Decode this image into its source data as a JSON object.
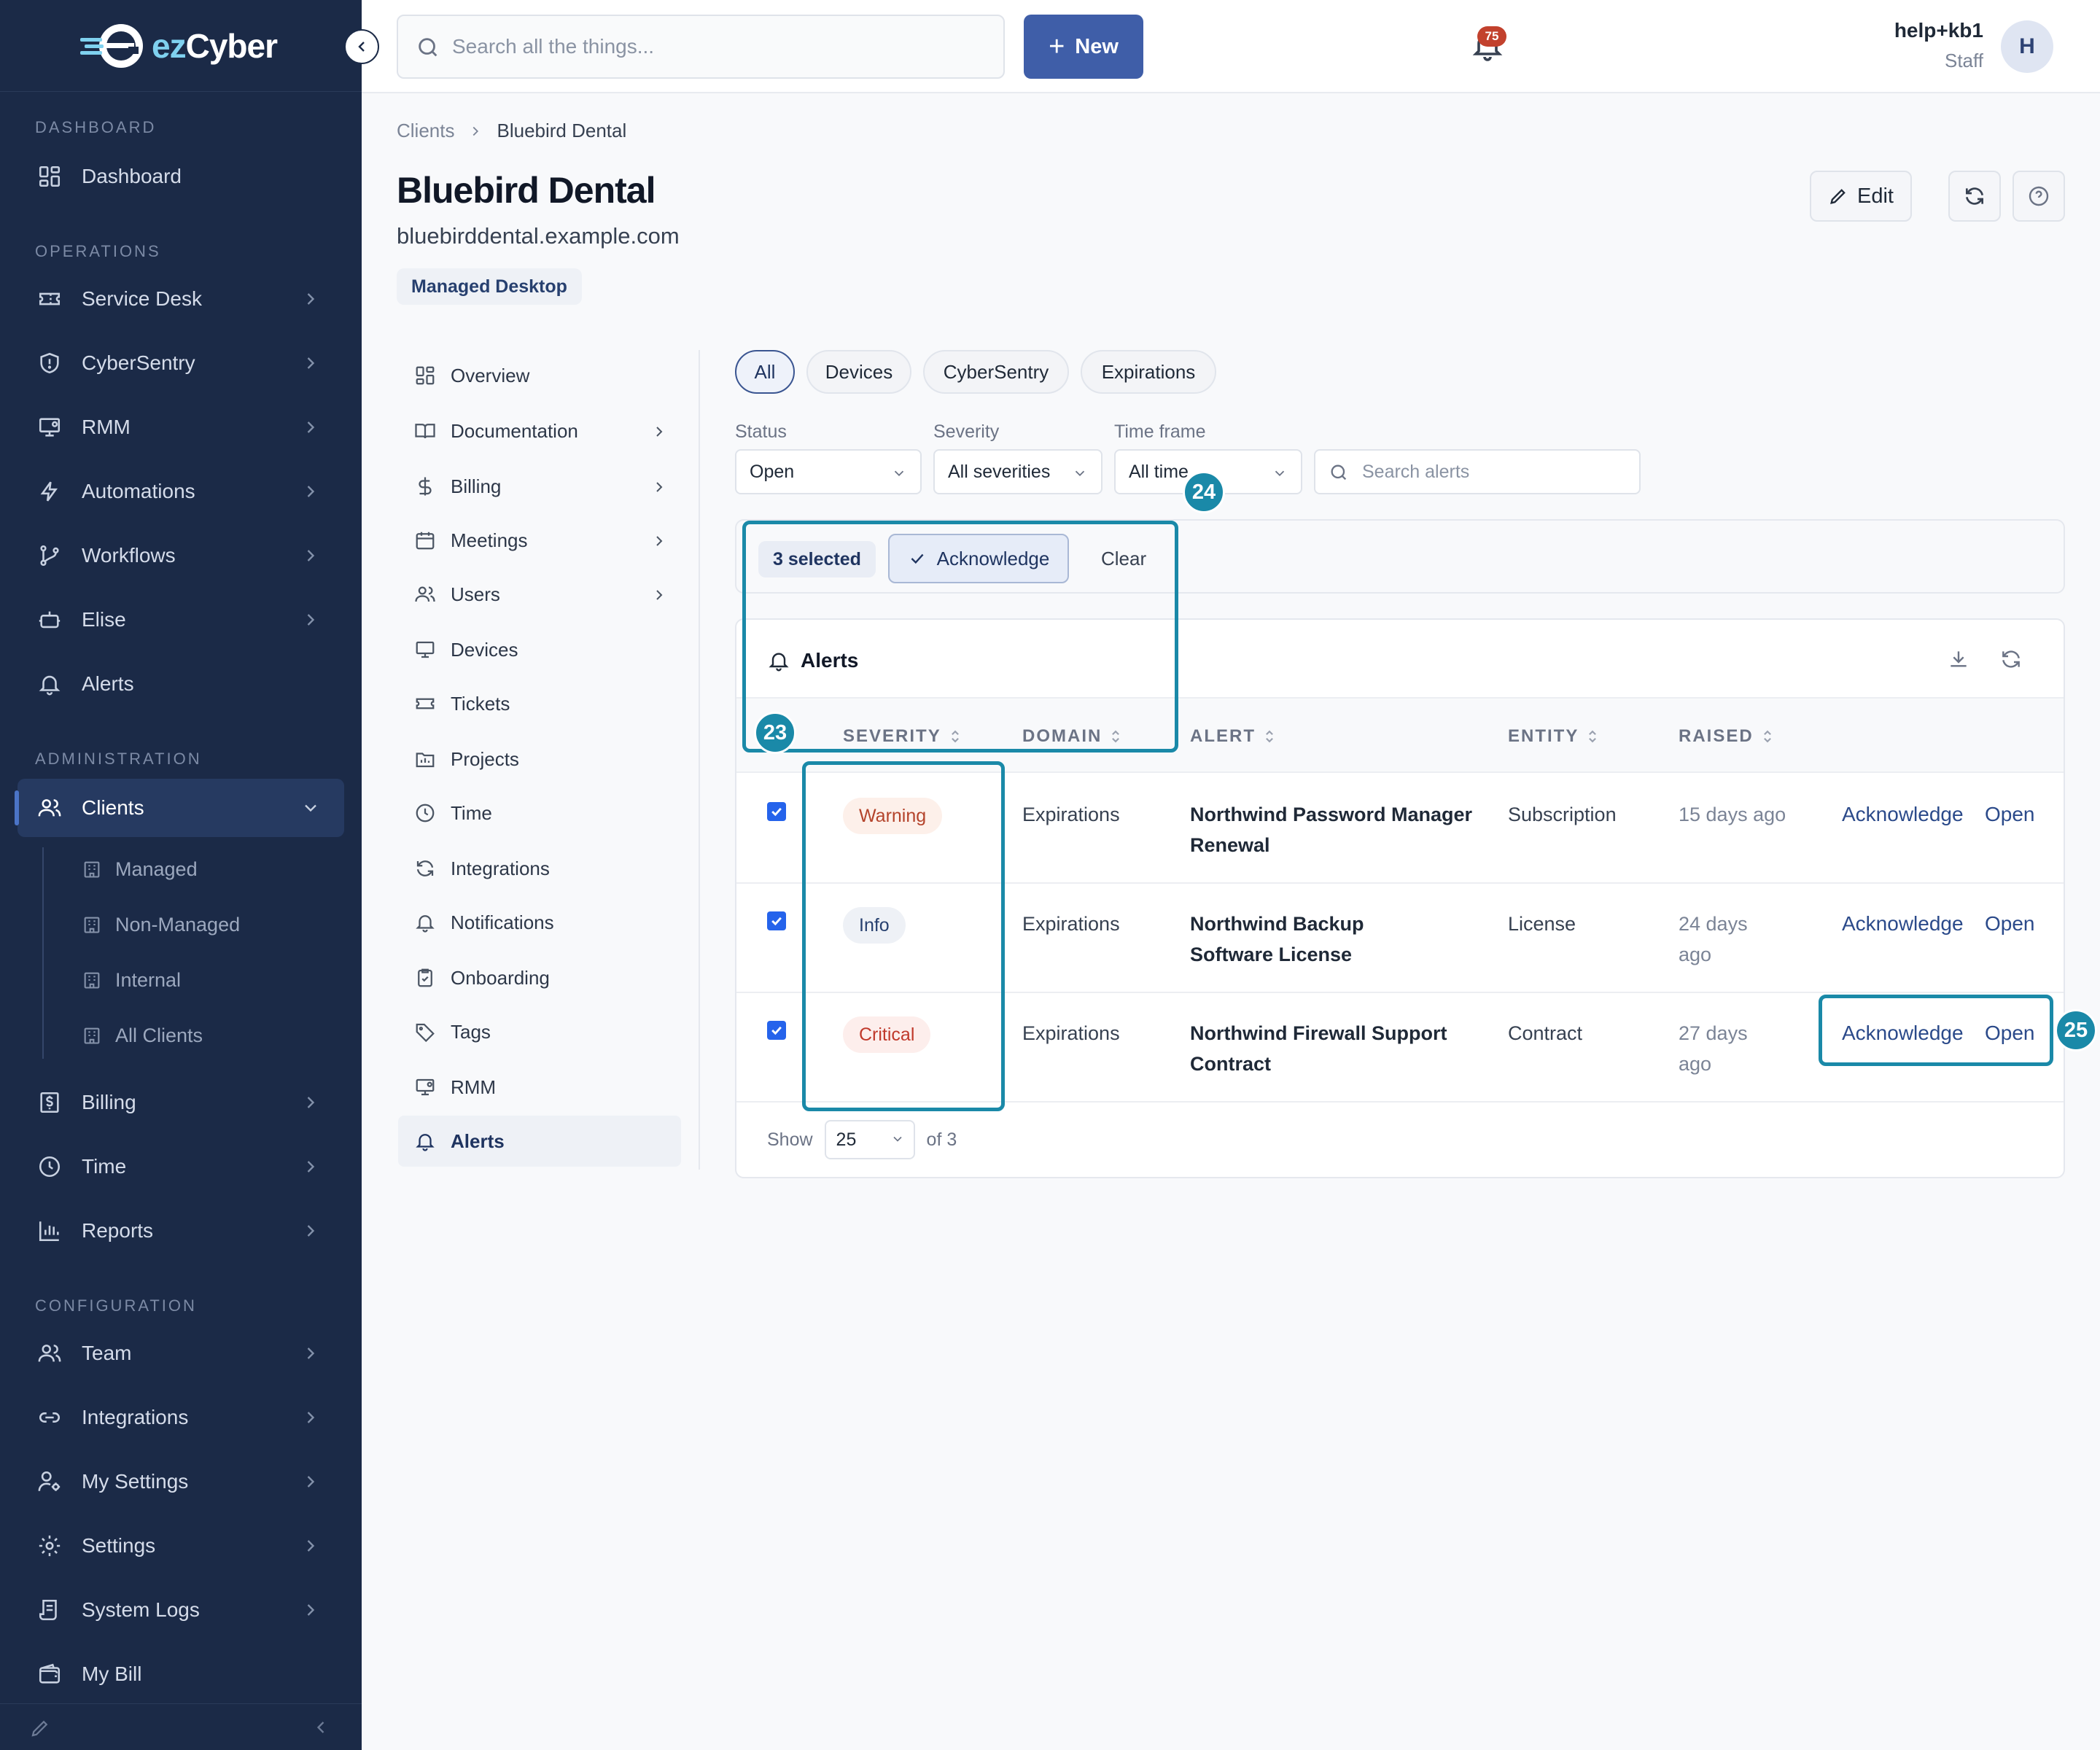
{
  "brand": {
    "prefix": "ez",
    "suffix": "Cyber"
  },
  "sidebar": {
    "sections": {
      "dashboard": "DASHBOARD",
      "operations": "OPERATIONS",
      "administration": "ADMINISTRATION",
      "configuration": "CONFIGURATION"
    },
    "items": {
      "dashboard": "Dashboard",
      "service_desk": "Service Desk",
      "cybersentry": "CyberSentry",
      "rmm": "RMM",
      "automations": "Automations",
      "workflows": "Workflows",
      "elise": "Elise",
      "alerts": "Alerts",
      "clients": "Clients",
      "billing": "Billing",
      "time": "Time",
      "reports": "Reports",
      "team": "Team",
      "integrations": "Integrations",
      "my_settings": "My Settings",
      "settings": "Settings",
      "system_logs": "System Logs",
      "my_bill": "My Bill"
    },
    "clients_sub": {
      "managed": "Managed",
      "non_managed": "Non-Managed",
      "internal": "Internal",
      "all": "All Clients"
    }
  },
  "topbar": {
    "search_placeholder": "Search all the things...",
    "new_label": "New",
    "notification_count": "75",
    "user_name": "help+kb1",
    "user_role": "Staff",
    "avatar_initial": "H"
  },
  "page": {
    "breadcrumb_root": "Clients",
    "breadcrumb_current": "Bluebird Dental",
    "title": "Bluebird Dental",
    "domain": "bluebirddental.example.com",
    "tag": "Managed Desktop",
    "edit_label": "Edit"
  },
  "subnav": {
    "overview": "Overview",
    "documentation": "Documentation",
    "billing": "Billing",
    "meetings": "Meetings",
    "users": "Users",
    "devices": "Devices",
    "tickets": "Tickets",
    "projects": "Projects",
    "time": "Time",
    "integrations": "Integrations",
    "notifications": "Notifications",
    "onboarding": "Onboarding",
    "tags": "Tags",
    "rmm": "RMM",
    "alerts": "Alerts"
  },
  "filters": {
    "tabs": {
      "all": "All",
      "devices": "Devices",
      "cybersentry": "CyberSentry",
      "expirations": "Expirations"
    },
    "status_label": "Status",
    "status_value": "Open",
    "severity_label": "Severity",
    "severity_value": "All severities",
    "timeframe_label": "Time frame",
    "timeframe_value": "All time",
    "search_placeholder": "Search alerts"
  },
  "bulk": {
    "selected": "3 selected",
    "acknowledge": "Acknowledge",
    "clear": "Clear"
  },
  "alerts": {
    "title": "Alerts",
    "columns": {
      "severity": "SEVERITY",
      "domain": "DOMAIN",
      "alert": "ALERT",
      "entity": "ENTITY",
      "raised": "RAISED"
    },
    "rows": [
      {
        "severity": "Warning",
        "domain": "Expirations",
        "alert": "Northwind Password Manager Renewal",
        "entity": "Subscription",
        "raised": "15 days ago",
        "ack": "Acknowledge",
        "open": "Open"
      },
      {
        "severity": "Info",
        "domain": "Expirations",
        "alert": "Northwind Backup Software License",
        "entity": "License",
        "raised": "24 days ago",
        "ack": "Acknowledge",
        "open": "Open"
      },
      {
        "severity": "Critical",
        "domain": "Expirations",
        "alert": "Northwind Firewall Support Contract",
        "entity": "Contract",
        "raised": "27 days ago",
        "ack": "Acknowledge",
        "open": "Open"
      }
    ],
    "pager": {
      "show": "Show",
      "page_size": "25",
      "of": "of 3"
    }
  },
  "annotations": {
    "n23": "23",
    "n24": "24",
    "n25": "25"
  },
  "colors": {
    "sidebar": "#1b2a47",
    "primary": "#3f5ea8",
    "annotation": "#1a89a8",
    "warning": "#b4432b",
    "critical": "#c0392b",
    "info": "#27406f"
  }
}
